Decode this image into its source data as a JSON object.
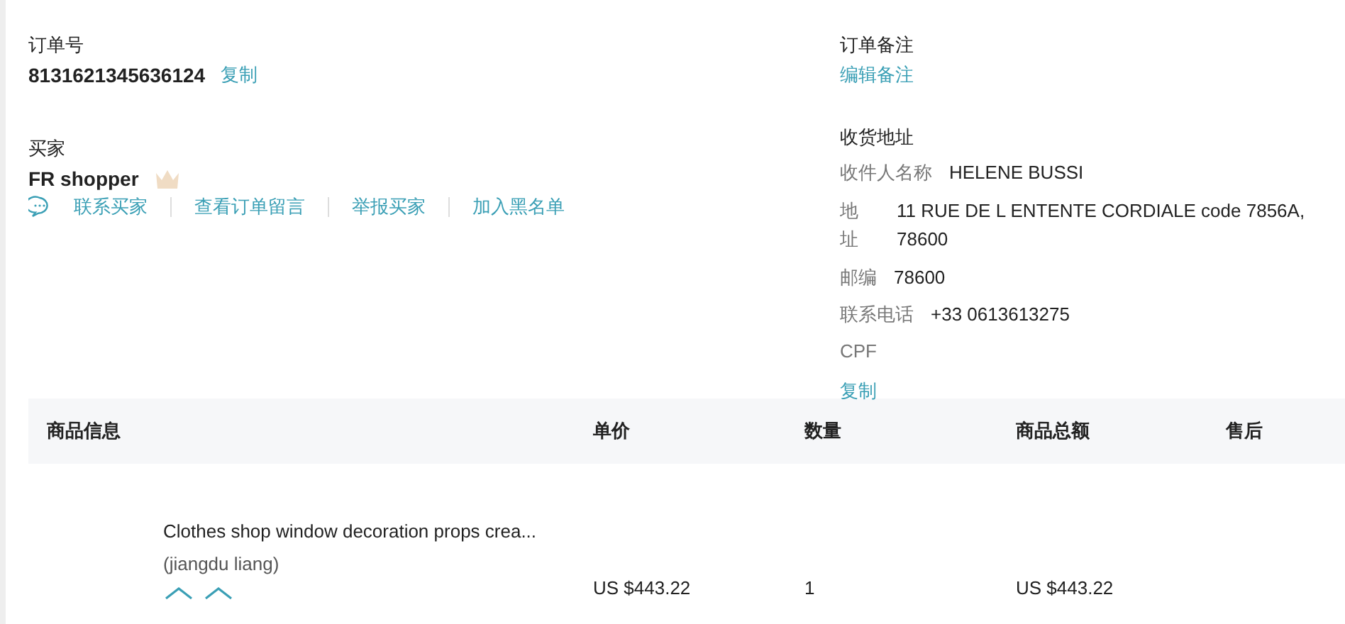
{
  "order": {
    "label": "订单号",
    "number": "8131621345636124",
    "copy": "复制"
  },
  "buyer": {
    "label": "买家",
    "name": "FR shopper",
    "actions": [
      "联系买家",
      "查看订单留言",
      "举报买家",
      "加入黑名单"
    ]
  },
  "note": {
    "label": "订单备注",
    "edit": "编辑备注"
  },
  "address": {
    "label": "收货地址",
    "fields": [
      {
        "label": "收件人名称",
        "value": "HELENE BUSSI"
      },
      {
        "label": "地址",
        "value": "11 RUE DE L ENTENTE CORDIALE code 7856A,",
        "value_2": "78600"
      },
      {
        "label": "邮编",
        "value": "78600"
      },
      {
        "label": "联系电话",
        "value": "+33 0613613275"
      },
      {
        "label": "CPF"
      }
    ],
    "copy": "复制"
  },
  "table": {
    "columns": [
      "商品信息",
      "单价",
      "数量",
      "商品总额",
      "售后"
    ],
    "rows": [
      {
        "title": "Clothes shop window decoration props crea...",
        "seller": "(jiangdu liang)",
        "price": "US $443.22",
        "quantity": "1",
        "total": "US $443.22"
      }
    ]
  }
}
